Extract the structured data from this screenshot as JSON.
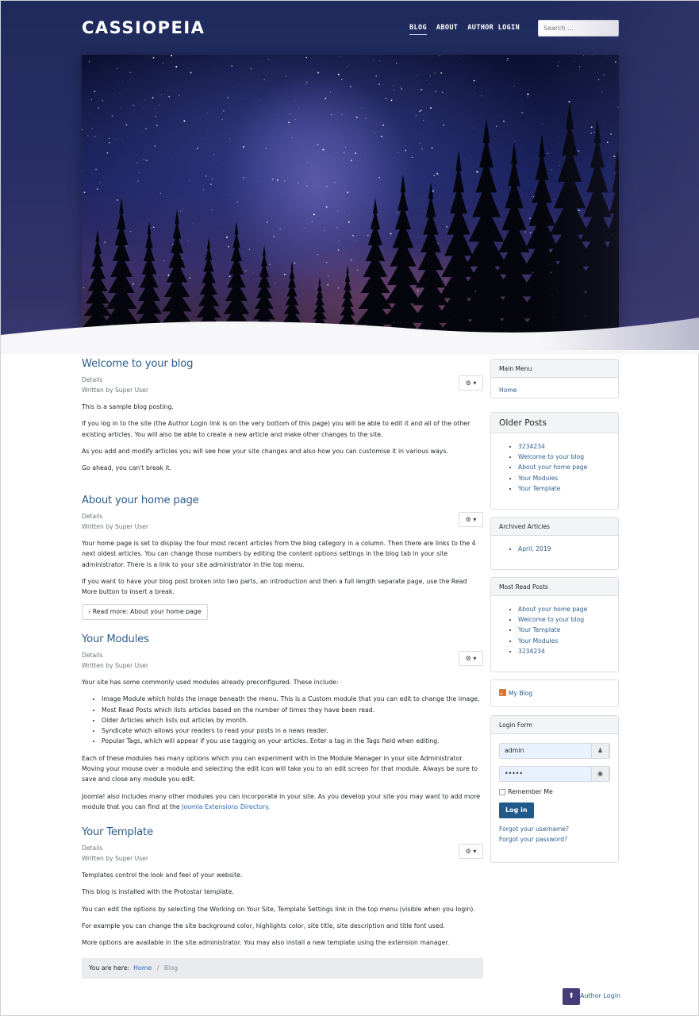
{
  "header": {
    "brand": "CASSIOPEIA",
    "nav": [
      {
        "label": "BLOG",
        "active": true
      },
      {
        "label": "ABOUT",
        "active": false
      },
      {
        "label": "AUTHOR LOGIN",
        "active": false
      }
    ],
    "search_placeholder": "Search ..."
  },
  "articles": [
    {
      "title": "Welcome to your blog",
      "details": "Details",
      "author": "Written by Super User",
      "paragraphs": [
        "This is a sample blog posting.",
        "If you log in to the site (the Author Login link is on the very bottom of this page) you will be able to edit it and all of the other existing articles. You will also be able to create a new article and make other changes to the site.",
        "As you add and modify articles you will see how your site changes and also how you can customise it in various ways.",
        "Go ahead, you can't break it."
      ]
    },
    {
      "title": "About your home page",
      "details": "Details",
      "author": "Written by Super User",
      "paragraphs": [
        "Your home page is set to display the four most recent articles from the blog category in a column. Then there are links to the 4 next oldest articles. You can change those numbers by editing the content options settings in the blog tab in your site administrator. There is a link to your site administrator in the top menu.",
        "If you want to have your blog post broken into two parts, an introduction and then a full length separate page, use the Read More button to insert a break."
      ],
      "read_more": "Read more: About your home page"
    },
    {
      "title": "Your Modules",
      "details": "Details",
      "author": "Written by Super User",
      "intro": "Your site has some commonly used modules already preconfigured. These include:",
      "list": [
        "Image Module which holds the image beneath the menu. This is a Custom module that you can edit to change the image.",
        "Most Read Posts which lists articles based on the number of times they have been read.",
        "Older Articles which lists out articles by month.",
        "Syndicate which allows your readers to read your posts in a news reader.",
        "Popular Tags, which will appear if you use tagging on your articles. Enter a tag in the Tags field when editing."
      ],
      "para2": "Each of these modules has many options which you can experiment with in the Module Manager in your site Administrator. Moving your mouse over a module and selecting the edit icon will take you to an edit screen for that module. Always be sure to save and close any module you edit.",
      "para3_text": "Joomla! also includes many other modules you can incorporate in your site. As you develop your site you may want to add more module that you can find at the ",
      "para3_link": "Joomla Extensions Directory."
    },
    {
      "title": "Your Template",
      "details": "Details",
      "author": "Written by Super User",
      "paragraphs": [
        "Templates control the look and feel of your website.",
        "This blog is installed with the Protostar template.",
        "You can edit the options by selecting the Working on Your Site, Template Settings link in the top menu (visible when you login).",
        "For example you can change the site background color, highlights color, site title, site description and title font used.",
        "More options are available in the site administrator. You may also install a new template using the extension manager."
      ]
    }
  ],
  "breadcrumb": {
    "prefix": "You are here:",
    "home": "Home",
    "separator": "/",
    "current": "Blog"
  },
  "sidebar": {
    "main_menu": {
      "title": "Main Menu",
      "items": [
        "Home"
      ]
    },
    "older_posts": {
      "title": "Older Posts",
      "items": [
        "3234234",
        "Welcome to your blog",
        "About your home page",
        "Your Modules",
        "Your Template"
      ]
    },
    "archived": {
      "title": "Archived Articles",
      "items": [
        "April, 2019"
      ]
    },
    "most_read": {
      "title": "Most Read Posts",
      "items": [
        "About your home page",
        "Welcome to your blog",
        "Your Template",
        "Your Modules",
        "3234234"
      ]
    },
    "syndicate": {
      "label": "My Blog"
    },
    "login": {
      "title": "Login Form",
      "username": "admin",
      "password_mask": "•••••",
      "remember": "Remember Me",
      "button": "Log in",
      "forgot_username": "Forgot your username?",
      "forgot_password": "Forgot your password?"
    }
  },
  "footer": {
    "back_to_top_icon": "arrow-up-icon",
    "link": "Author Login"
  },
  "colors": {
    "header_bg": "#252e63",
    "link": "#2c5d8c",
    "login_button": "#1f5a8a",
    "back_to_top": "#443d7a"
  }
}
